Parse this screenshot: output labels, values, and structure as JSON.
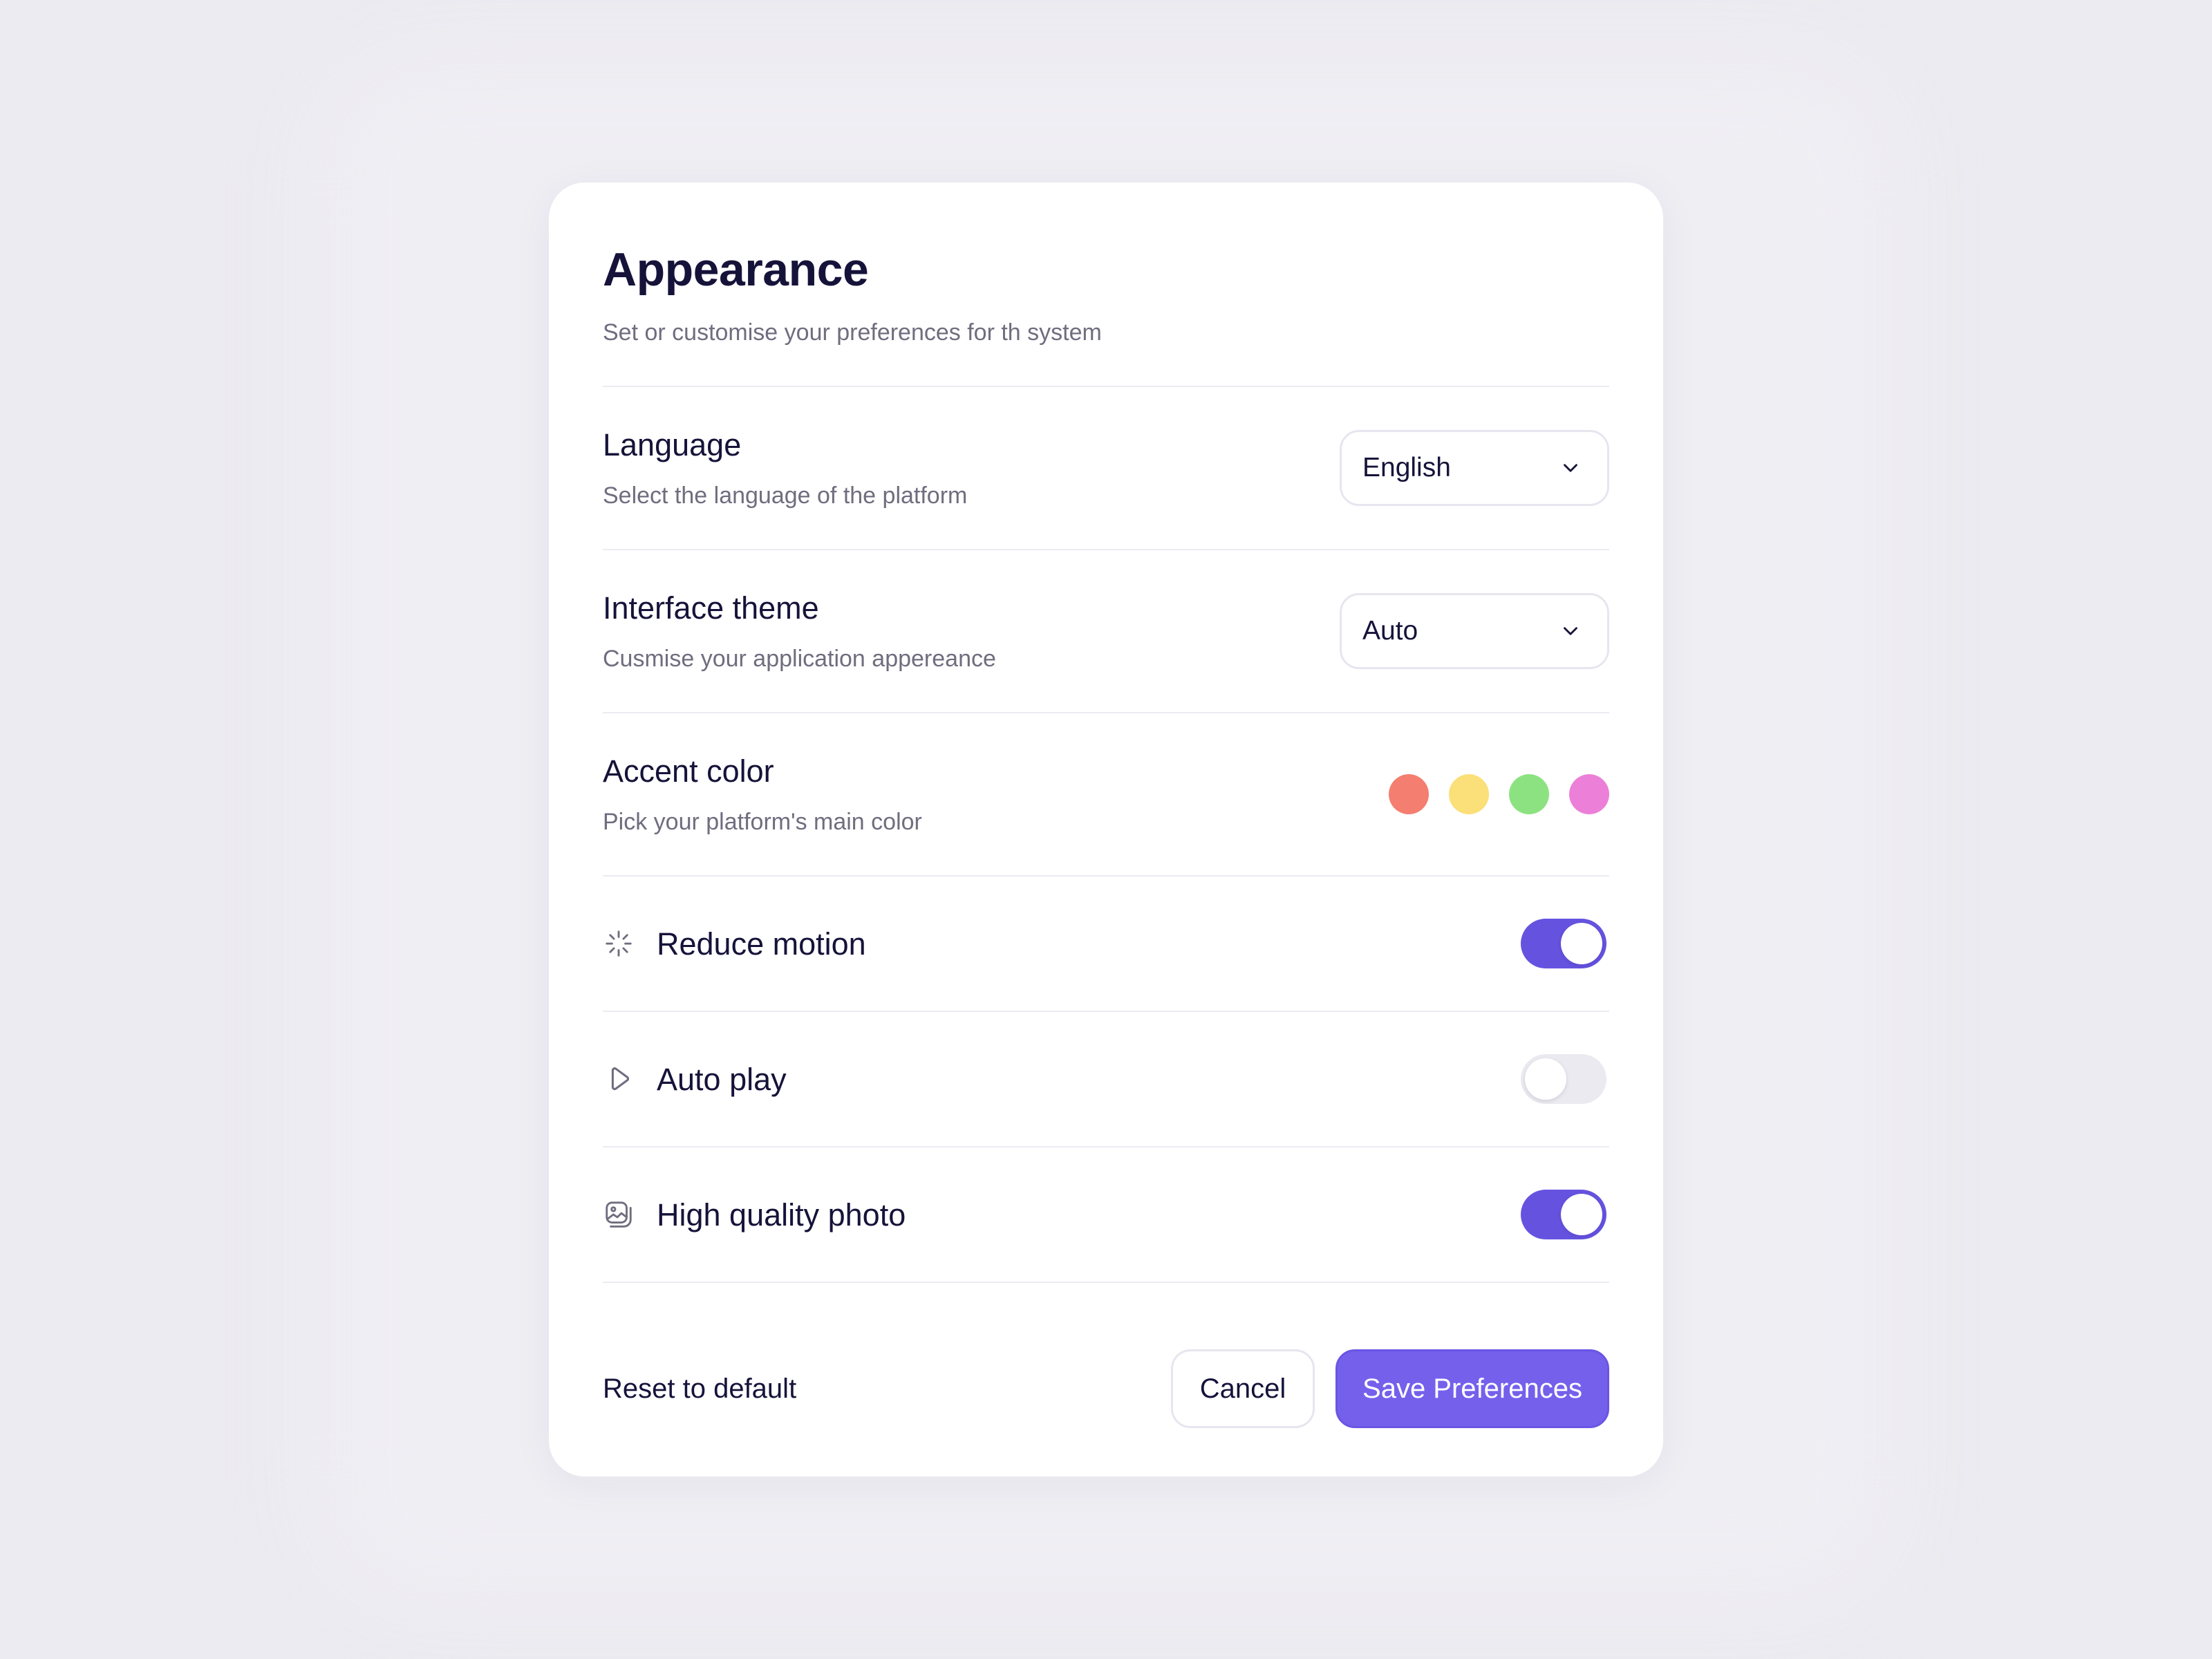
{
  "header": {
    "title": "Appearance",
    "subtitle": "Set or customise your preferences for th system"
  },
  "settings": {
    "language": {
      "label": "Language",
      "description": "Select the language of the platform",
      "value": "English"
    },
    "theme": {
      "label": "Interface theme",
      "description": "Cusmise your application appereance",
      "value": "Auto"
    },
    "accent": {
      "label": "Accent color",
      "description": "Pick your platform's main color",
      "colors": [
        "#f47e6f",
        "#fbdf78",
        "#8ce280",
        "#ec80d8"
      ]
    }
  },
  "toggles": {
    "reduce_motion": {
      "label": "Reduce motion",
      "icon": "loader-icon",
      "on": true
    },
    "auto_play": {
      "label": "Auto play",
      "icon": "play-icon",
      "on": false
    },
    "high_quality_photo": {
      "label": "High quality photo",
      "icon": "image-icon",
      "on": true
    }
  },
  "footer": {
    "reset_label": "Reset to default",
    "cancel_label": "Cancel",
    "save_label": "Save Preferences"
  },
  "colors": {
    "accent": "#6553e0",
    "primary_button": "#7560ec",
    "background": "#ecebf1"
  }
}
